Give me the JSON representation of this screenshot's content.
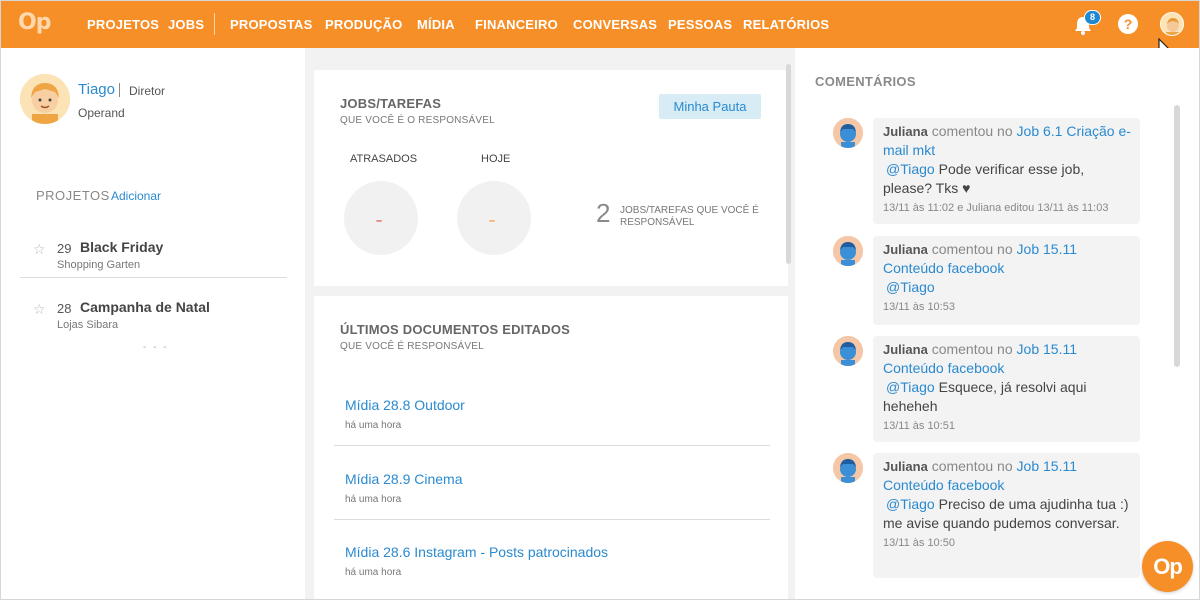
{
  "brand": {
    "logo_text": "Op",
    "accent": "#f78f29",
    "link_color": "#2a8ad0"
  },
  "nav": {
    "items": [
      {
        "label": "PROJETOS"
      },
      {
        "label": "JOBS"
      },
      {
        "label": "PROPOSTAS"
      },
      {
        "label": "PRODUÇÃO"
      },
      {
        "label": "MÍDIA"
      },
      {
        "label": "FINANCEIRO"
      },
      {
        "label": "CONVERSAS"
      },
      {
        "label": "PESSOAS"
      },
      {
        "label": "RELATÓRIOS"
      }
    ],
    "notifications_count": "8",
    "help_label": "?"
  },
  "profile": {
    "name": "Tiago",
    "role": "Diretor",
    "company": "Operand"
  },
  "projects": {
    "title": "PROJETOS",
    "add_label": "Adicionar",
    "items": [
      {
        "number": "29",
        "name": "Black Friday",
        "client": "Shopping Garten"
      },
      {
        "number": "28",
        "name": "Campanha de Natal",
        "client": "Lojas Sibara"
      }
    ],
    "more": "- - -"
  },
  "tasks": {
    "title": "JOBS/TAREFAS",
    "subtitle": "QUE VOCÊ É O RESPONSÁVEL",
    "button": "Minha Pauta",
    "late_label": "ATRASADOS",
    "today_label": "HOJE",
    "late_value": "–",
    "today_value": "–",
    "late_color": "#e04a3a",
    "today_color": "#f78f29",
    "total": "2",
    "total_text": "JOBS/TAREFAS QUE VOCÊ É RESPONSÁVEL"
  },
  "documents": {
    "title": "ÚLTIMOS DOCUMENTOS EDITADOS",
    "subtitle": "QUE VOCÊ É RESPONSÁVEL",
    "items": [
      {
        "title": "Mídia 28.8 Outdoor",
        "time": "há uma hora"
      },
      {
        "title": "Mídia 28.9 Cinema",
        "time": "há uma hora"
      },
      {
        "title": "Mídia 28.6 Instagram - Posts patrocinados",
        "time": "há uma hora"
      }
    ]
  },
  "comments": {
    "title": "COMENTÁRIOS",
    "items": [
      {
        "author": "Juliana",
        "action": "comentou no",
        "target": "Job 6.1 Criação e-mail mkt",
        "mention": "@Tiago",
        "text": "Pode verificar esse job, please? Tks ♥",
        "time": "13/11 às 11:02 e Juliana editou 13/11 às 11:03"
      },
      {
        "author": "Juliana",
        "action": "comentou no",
        "target": "Job 15.11 Conteúdo facebook",
        "mention": "@Tiago",
        "text": "",
        "time": "13/11 às 10:53"
      },
      {
        "author": "Juliana",
        "action": "comentou no",
        "target": "Job 15.11 Conteúdo facebook",
        "mention": "@Tiago",
        "text": "Esquece, já resolvi aqui heheheh",
        "time": "13/11 às 10:51"
      },
      {
        "author": "Juliana",
        "action": "comentou no",
        "target": "Job 15.11 Conteúdo facebook",
        "mention": "@Tiago",
        "text": "Preciso de uma ajudinha tua :) me avise quando pudemos conversar.",
        "time": "13/11 às 10:50"
      }
    ]
  },
  "fab_label": "Op"
}
